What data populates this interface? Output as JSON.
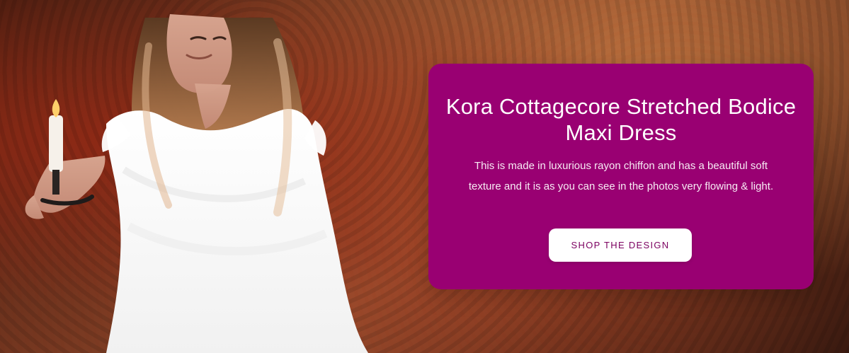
{
  "hero": {
    "title": "Kora Cottagecore Stretched Bodice Maxi Dress",
    "description": "This is made in luxurious rayon chiffon and has a beautiful soft texture and it is as you can see in the photos very flowing & light.",
    "cta_label": "SHOP THE DESIGN",
    "image_icon": "model-wearing-dress-image",
    "colors": {
      "card_bg": "#990072",
      "cta_text": "#7b0060",
      "cta_bg": "#ffffff"
    }
  }
}
